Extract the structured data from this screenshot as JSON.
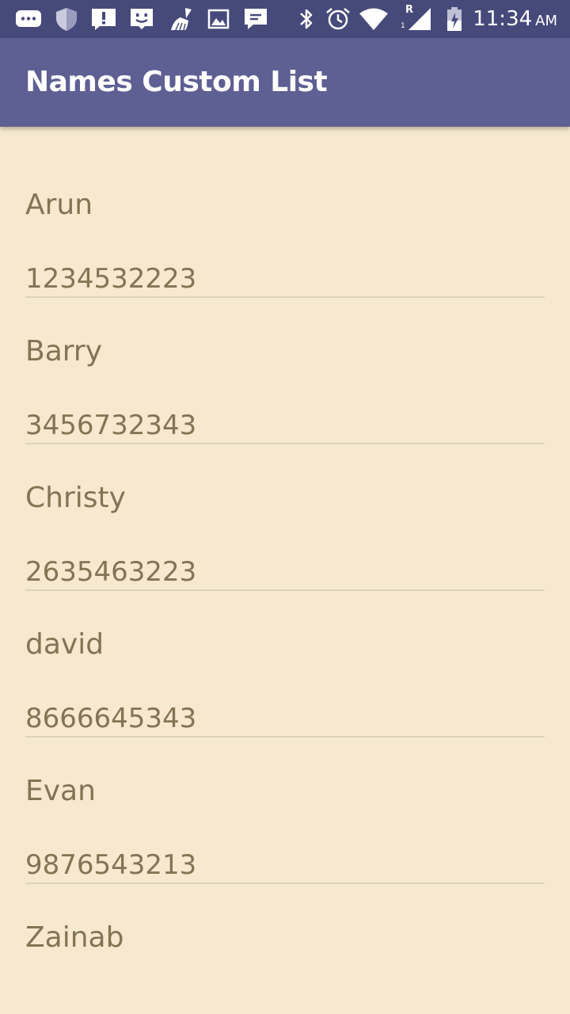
{
  "status_bar": {
    "time": "11:34",
    "ampm": "AM",
    "network_label": "R",
    "sim_slot": "1",
    "icons": [
      "chat-bubble-icon",
      "shield-icon",
      "alert-icon",
      "face-icon",
      "broom-icon",
      "image-icon",
      "sms-icon",
      "bluetooth-icon",
      "alarm-icon",
      "wifi-icon",
      "signal-icon",
      "battery-icon"
    ]
  },
  "app_bar": {
    "title": "Names Custom List"
  },
  "contacts": [
    {
      "name": "Arun",
      "phone": "1234532223"
    },
    {
      "name": "Barry",
      "phone": "3456732343"
    },
    {
      "name": "Christy",
      "phone": "2635463223"
    },
    {
      "name": "david",
      "phone": "8666645343"
    },
    {
      "name": "Evan",
      "phone": "9876543213"
    },
    {
      "name": "Zainab",
      "phone": ""
    }
  ],
  "colors": {
    "status_bar": "#464a7b",
    "app_bar": "#5e6094",
    "background": "#f7e9cf",
    "text": "#847455",
    "divider": "#ddd3bd"
  }
}
